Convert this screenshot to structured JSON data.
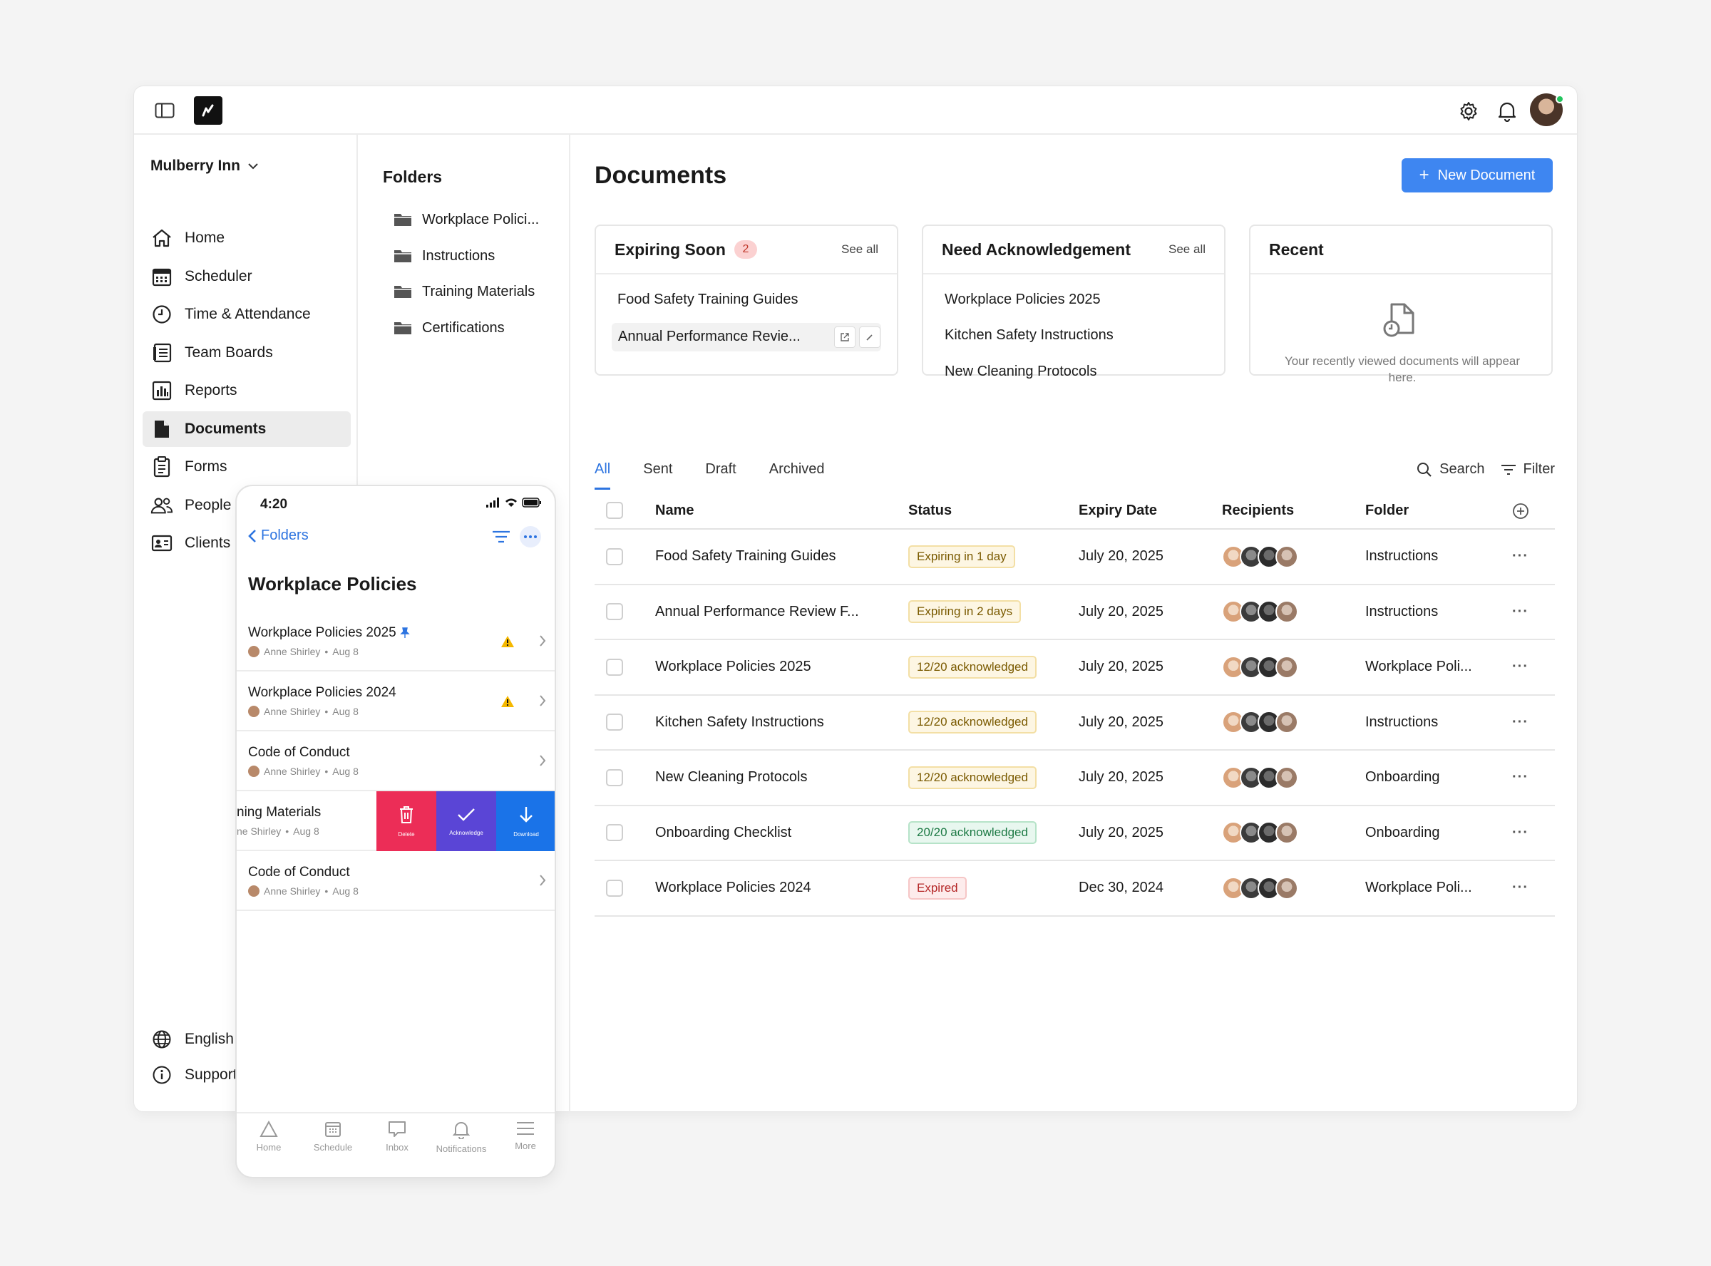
{
  "app": {
    "org_name": "Mulberry Inn"
  },
  "sidebar": {
    "items": [
      {
        "label": "Home",
        "icon": "home-icon"
      },
      {
        "label": "Scheduler",
        "icon": "calendar-icon"
      },
      {
        "label": "Time & Attendance",
        "icon": "clock-icon"
      },
      {
        "label": "Team Boards",
        "icon": "board-icon"
      },
      {
        "label": "Reports",
        "icon": "chart-icon"
      },
      {
        "label": "Documents",
        "icon": "document-icon",
        "active": true
      },
      {
        "label": "Forms",
        "icon": "clipboard-icon"
      },
      {
        "label": "People",
        "icon": "people-icon"
      },
      {
        "label": "Clients",
        "icon": "id-card-icon"
      }
    ],
    "bottom": [
      {
        "label": "English",
        "icon": "globe-icon"
      },
      {
        "label": "Support",
        "icon": "info-icon"
      }
    ]
  },
  "folders": {
    "title": "Folders",
    "items": [
      "Workplace Polici...",
      "Instructions",
      "Training Materials",
      "Certifications"
    ]
  },
  "main": {
    "title": "Documents",
    "new_button": "New Document",
    "cards": {
      "expiring": {
        "title": "Expiring Soon",
        "count": "2",
        "see_all": "See all",
        "items": [
          "Food Safety Training Guides",
          "Annual Performance Revie..."
        ]
      },
      "acknowledgement": {
        "title": "Need Acknowledgement",
        "see_all": "See all",
        "items": [
          "Workplace Policies 2025",
          "Kitchen Safety Instructions",
          "New Cleaning Protocols"
        ]
      },
      "recent": {
        "title": "Recent",
        "empty_text": "Your recently viewed documents will appear here."
      }
    },
    "tabs": [
      "All",
      "Sent",
      "Draft",
      "Archived"
    ],
    "search_label": "Search",
    "filter_label": "Filter",
    "table": {
      "headers": [
        "Name",
        "Status",
        "Expiry Date",
        "Recipients",
        "Folder"
      ],
      "rows": [
        {
          "name": "Food Safety Training Guides",
          "status": "Expiring in 1 day",
          "status_kind": "warn",
          "date": "July 20, 2025",
          "folder": "Instructions"
        },
        {
          "name": "Annual Performance Review F...",
          "status": "Expiring in 2 days",
          "status_kind": "warn",
          "date": "July 20, 2025",
          "folder": "Instructions"
        },
        {
          "name": "Workplace Policies 2025",
          "status": "12/20 acknowledged",
          "status_kind": "warn",
          "date": "July 20, 2025",
          "folder": "Workplace Poli..."
        },
        {
          "name": "Kitchen Safety Instructions",
          "status": "12/20 acknowledged",
          "status_kind": "warn",
          "date": "July 20, 2025",
          "folder": "Instructions"
        },
        {
          "name": "New Cleaning Protocols",
          "status": "12/20 acknowledged",
          "status_kind": "warn",
          "date": "July 20, 2025",
          "folder": "Onboarding"
        },
        {
          "name": "Onboarding Checklist",
          "status": "20/20 acknowledged",
          "status_kind": "ok",
          "date": "July 20, 2025",
          "folder": "Onboarding"
        },
        {
          "name": "Workplace Policies 2024",
          "status": "Expired",
          "status_kind": "bad",
          "date": "Dec 30, 2024",
          "folder": "Workplace Poli..."
        }
      ]
    }
  },
  "phone": {
    "time": "4:20",
    "back_label": "Folders",
    "title": "Workplace Policies",
    "items": [
      {
        "title": "Workplace Policies 2025",
        "author": "Anne Shirley",
        "date": "Aug 8",
        "pinned": true,
        "warning": true
      },
      {
        "title": "Workplace Policies 2024",
        "author": "Anne Shirley",
        "date": "Aug 8",
        "warning": true
      },
      {
        "title": "Code of Conduct",
        "author": "Anne Shirley",
        "date": "Aug 8"
      },
      {
        "title": "ning Materials",
        "author": "ne Shirley",
        "date": "Aug 8",
        "swiped": true
      },
      {
        "title": "Code of Conduct",
        "author": "Anne Shirley",
        "date": "Aug 8"
      }
    ],
    "swipe_actions": [
      {
        "label": "Delete",
        "color": "#ec2d57"
      },
      {
        "label": "Acknowledge",
        "color": "#5a45d6"
      },
      {
        "label": "Download",
        "color": "#1a73e8"
      }
    ],
    "tabbar": [
      "Home",
      "Schedule",
      "Inbox",
      "Notifications",
      "More"
    ]
  },
  "colors": {
    "accent": "#3e86f1",
    "active_tab": "#2d74e0",
    "online": "#22c55e"
  }
}
